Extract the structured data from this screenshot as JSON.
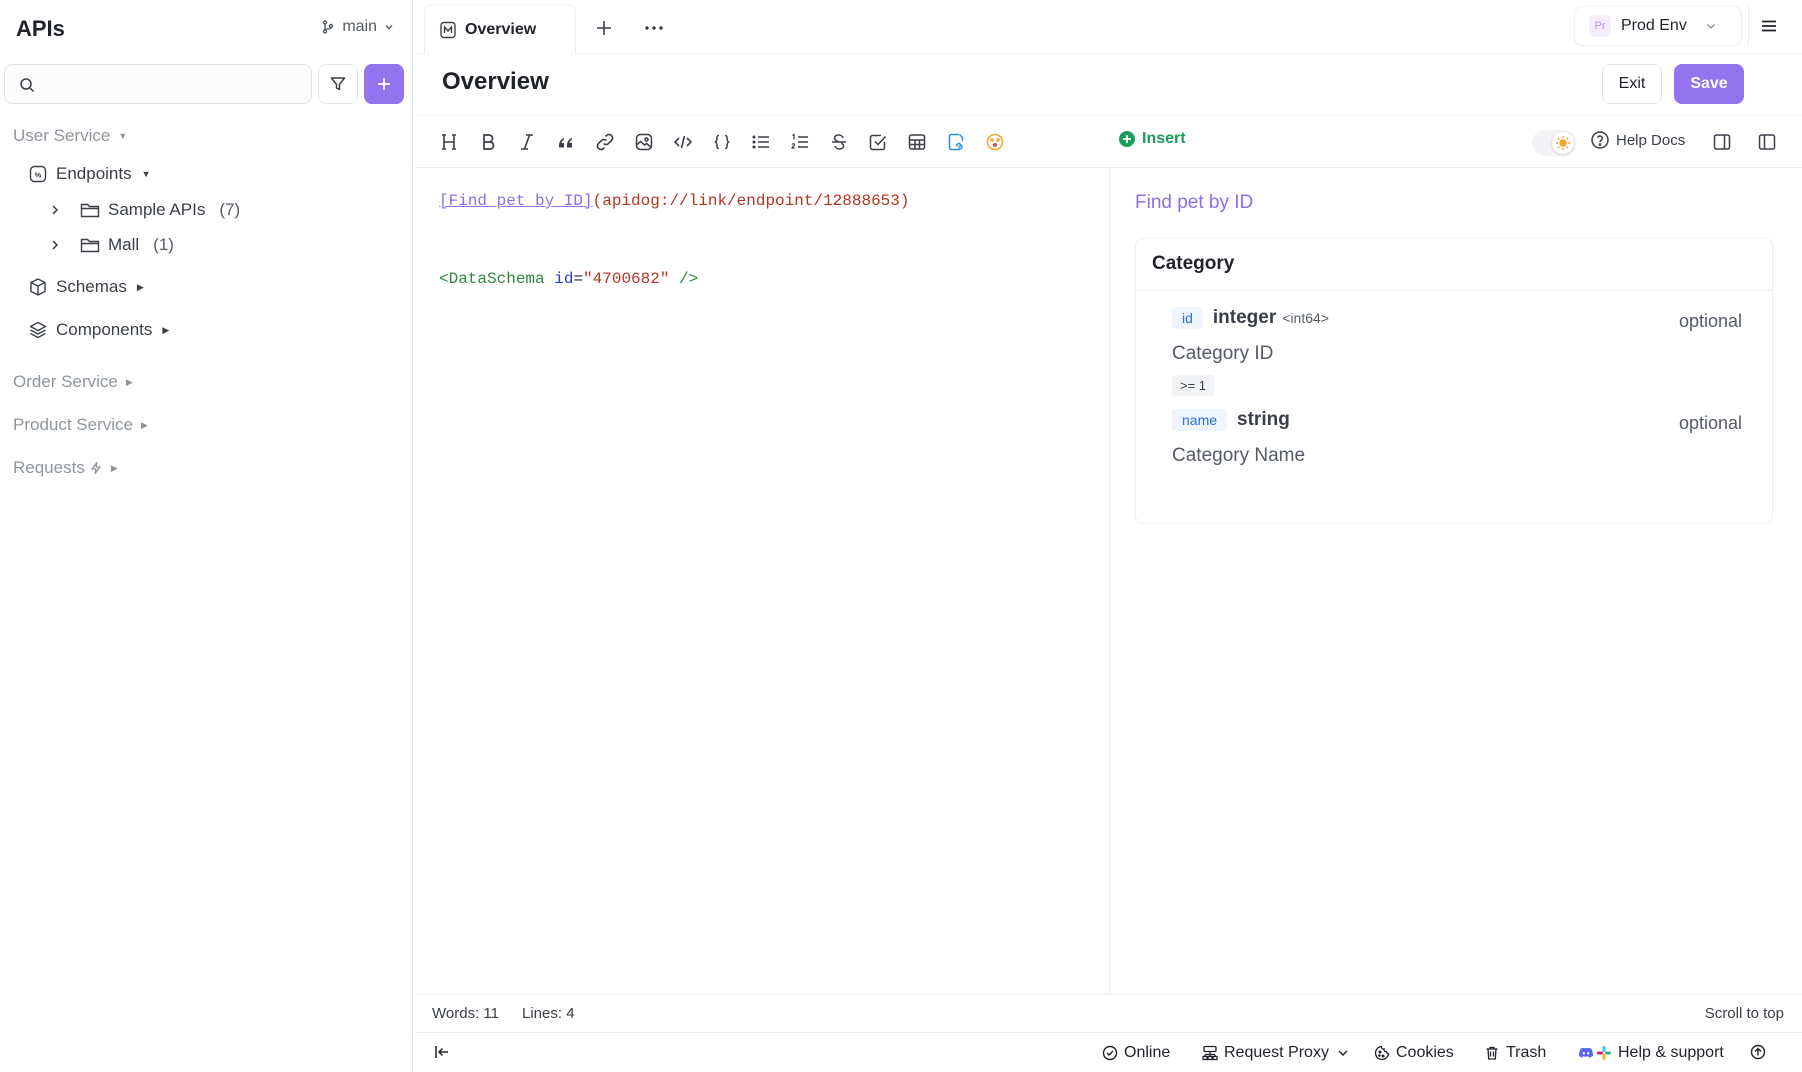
{
  "sidebar": {
    "title": "APIs",
    "branch": "main",
    "search_placeholder": "",
    "tree": {
      "user_service": "User Service",
      "endpoints": "Endpoints",
      "sample_apis": "Sample APIs",
      "sample_apis_count": "(7)",
      "mall": "Mall",
      "mall_count": "(1)",
      "schemas": "Schemas",
      "components": "Components",
      "order_service": "Order Service",
      "product_service": "Product Service",
      "requests": "Requests"
    }
  },
  "tabs": {
    "active": "Overview"
  },
  "environment": {
    "badge": "Pr",
    "name": "Prod Env"
  },
  "page": {
    "title": "Overview",
    "exit_label": "Exit",
    "save_label": "Save"
  },
  "toolbar": {
    "insert_label": "Insert",
    "help_docs_label": "Help Docs"
  },
  "editor": {
    "line1_link_text": "[Find pet by ID]",
    "line1_url": "(apidog://link/endpoint/12888653)",
    "line3_open": "<DataSchema",
    "line3_attr": "id",
    "line3_eq": "=",
    "line3_value": "\"4700682\"",
    "line3_close": "/>"
  },
  "preview": {
    "link_title": "Find pet by ID",
    "schema_title": "Category",
    "fields": [
      {
        "name": "id",
        "type": "integer",
        "format": "<int64>",
        "required": "optional",
        "description": "Category ID",
        "constraint": ">= 1"
      },
      {
        "name": "name",
        "type": "string",
        "format": "",
        "required": "optional",
        "description": "Category Name",
        "constraint": ""
      }
    ]
  },
  "status": {
    "words": "Words: 11",
    "lines": "Lines: 4",
    "scroll_top": "Scroll to top"
  },
  "footer": {
    "online": "Online",
    "request_proxy": "Request Proxy",
    "cookies": "Cookies",
    "trash": "Trash",
    "help_support": "Help & support"
  },
  "colors": {
    "accent": "#9373ee",
    "link": "#8d6ee6",
    "insert_green": "#1a9c5a",
    "pill_blue": "#2e6cd6"
  }
}
